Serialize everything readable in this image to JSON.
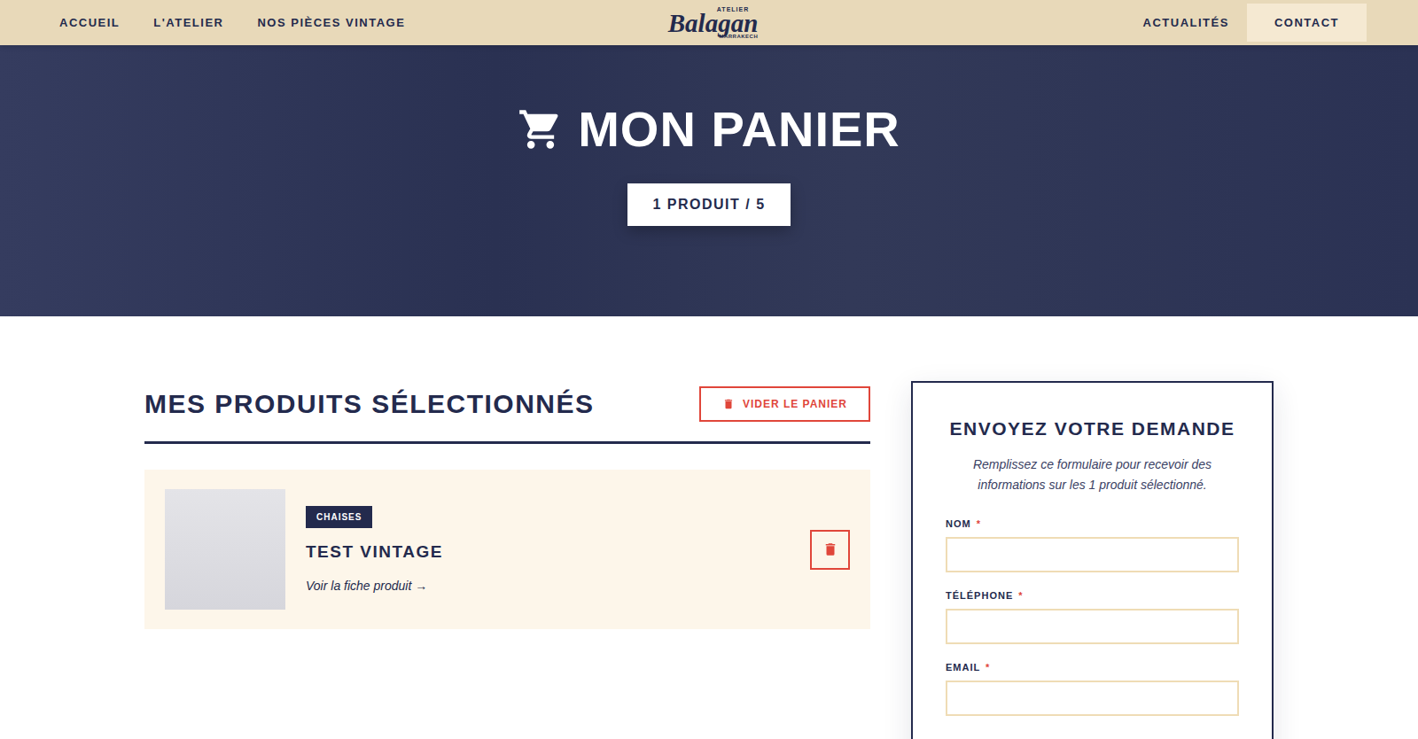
{
  "nav": {
    "left": [
      {
        "label": "ACCUEIL"
      },
      {
        "label": "L'ATELIER"
      },
      {
        "label": "NOS PIÈCES VINTAGE"
      }
    ],
    "logo": {
      "top": "ATELIER",
      "name": "Balagan",
      "bottom": "MARRAKECH"
    },
    "right": [
      {
        "label": "ACTUALITÉS"
      }
    ],
    "contact": "CONTACT"
  },
  "hero": {
    "title": "MON PANIER",
    "count": "1 PRODUIT / 5"
  },
  "cart": {
    "heading": "MES PRODUITS SÉLECTIONNÉS",
    "clear_button": "VIDER LE PANIER",
    "products": [
      {
        "category": "CHAISES",
        "name": "TEST VINTAGE",
        "link": "Voir la fiche produit →"
      }
    ]
  },
  "form": {
    "title": "ENVOYEZ VOTRE DEMANDE",
    "description": "Remplissez ce formulaire pour recevoir des informations sur les 1 produit sélectionné.",
    "fields": [
      {
        "label": "NOM",
        "marker": "*",
        "required": true,
        "value": ""
      },
      {
        "label": "TÉLÉPHONE",
        "marker": "*",
        "required": true,
        "value": ""
      },
      {
        "label": "EMAIL",
        "marker": "*",
        "required": true,
        "value": ""
      }
    ]
  }
}
